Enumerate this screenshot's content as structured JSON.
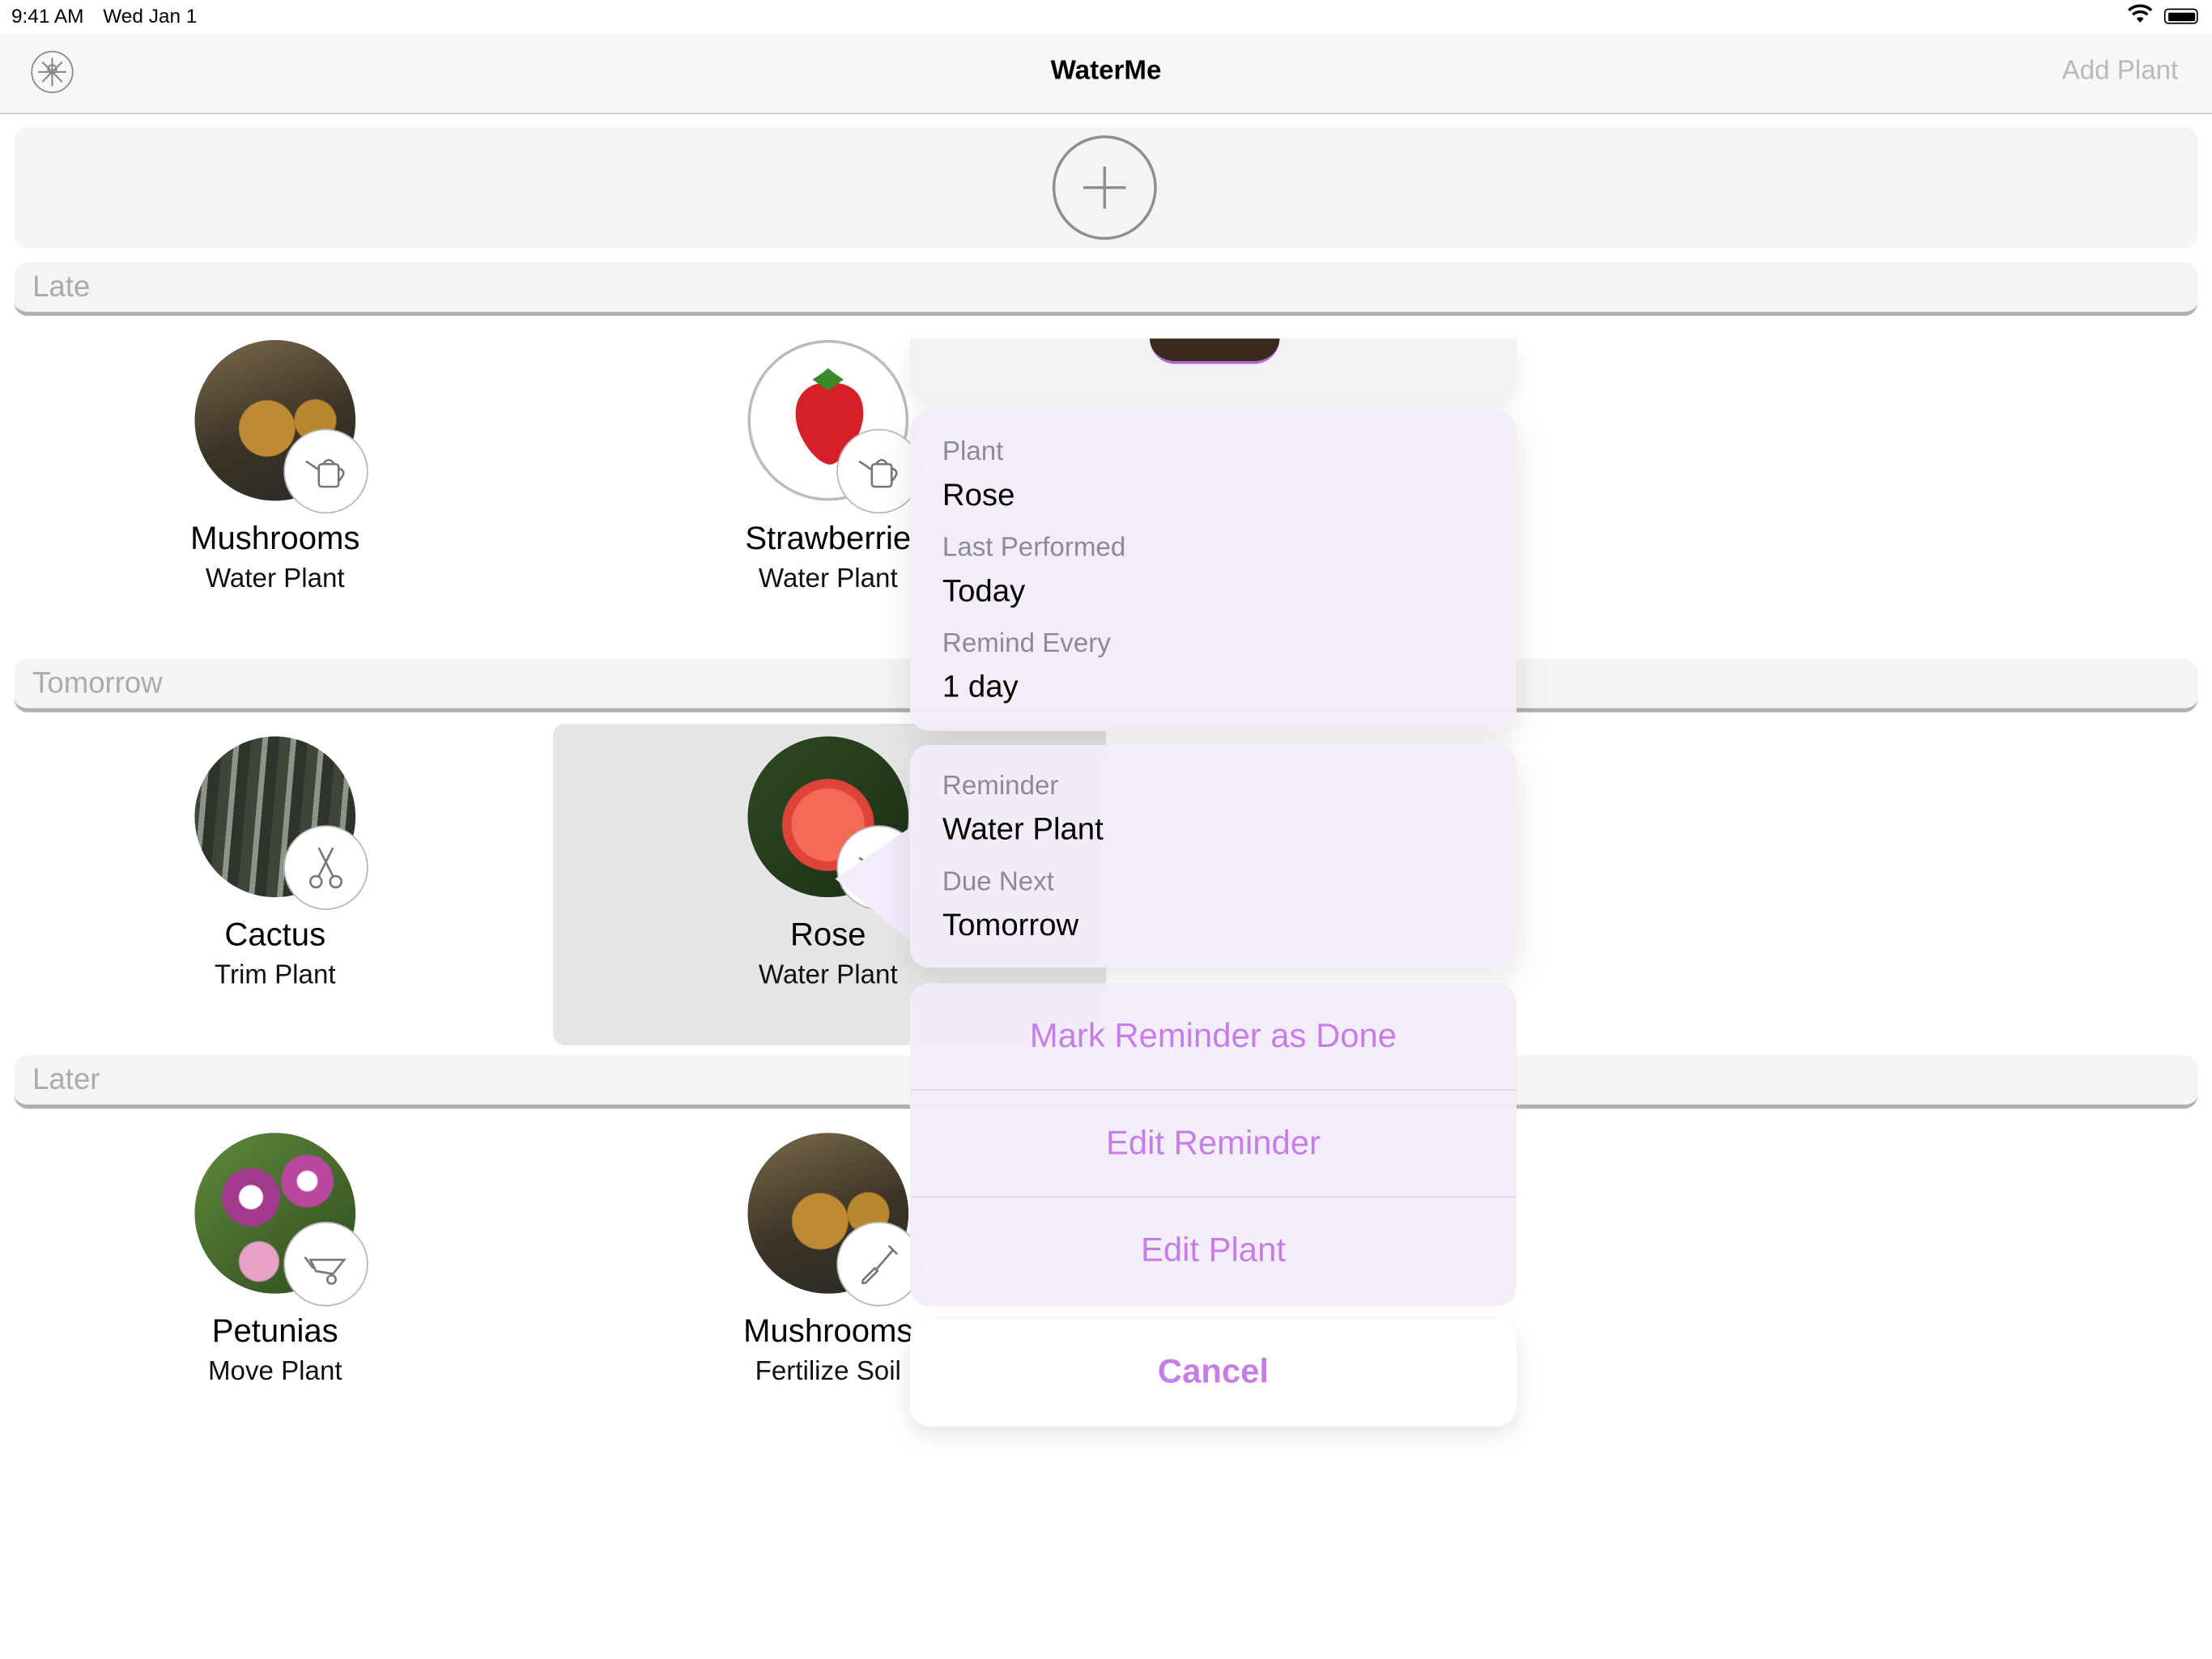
{
  "status_bar": {
    "time": "9:41 AM",
    "date": "Wed Jan 1"
  },
  "navbar": {
    "title": "WaterMe",
    "add_button": "Add Plant"
  },
  "sections": [
    {
      "title": "Late"
    },
    {
      "title": "Tomorrow"
    },
    {
      "title": "Later"
    }
  ],
  "plants": {
    "late_1": {
      "name": "Mushrooms",
      "task": "Water Plant",
      "badge_icon": "watering-can-icon"
    },
    "late_2": {
      "name": "Strawberrie",
      "task": "Water Plant",
      "badge_icon": "watering-can-icon"
    },
    "tomorrow_1": {
      "name": "Cactus",
      "task": "Trim Plant",
      "badge_icon": "scissors-icon"
    },
    "tomorrow_2": {
      "name": "Rose",
      "task": "Water Plant",
      "badge_icon": "watering-can-icon"
    },
    "later_1": {
      "name": "Petunias",
      "task": "Move Plant",
      "badge_icon": "wheelbarrow-icon"
    },
    "later_2": {
      "name": "Mushrooms",
      "task": "Fertilize Soil",
      "badge_icon": "shovel-icon"
    }
  },
  "popup": {
    "plant_label": "Plant",
    "plant_value": "Rose",
    "last_label": "Last Performed",
    "last_value": "Today",
    "remind_label": "Remind Every",
    "remind_value": "1 day",
    "reminder_label": "Reminder",
    "reminder_value": "Water Plant",
    "due_label": "Due Next",
    "due_value": "Tomorrow",
    "actions": [
      "Mark Reminder as Done",
      "Edit Reminder",
      "Edit Plant"
    ],
    "cancel": "Cancel"
  },
  "colors": {
    "accent": "#c67ee6",
    "nav_inactive": "#b9b9bd",
    "section_text": "#ababab"
  }
}
